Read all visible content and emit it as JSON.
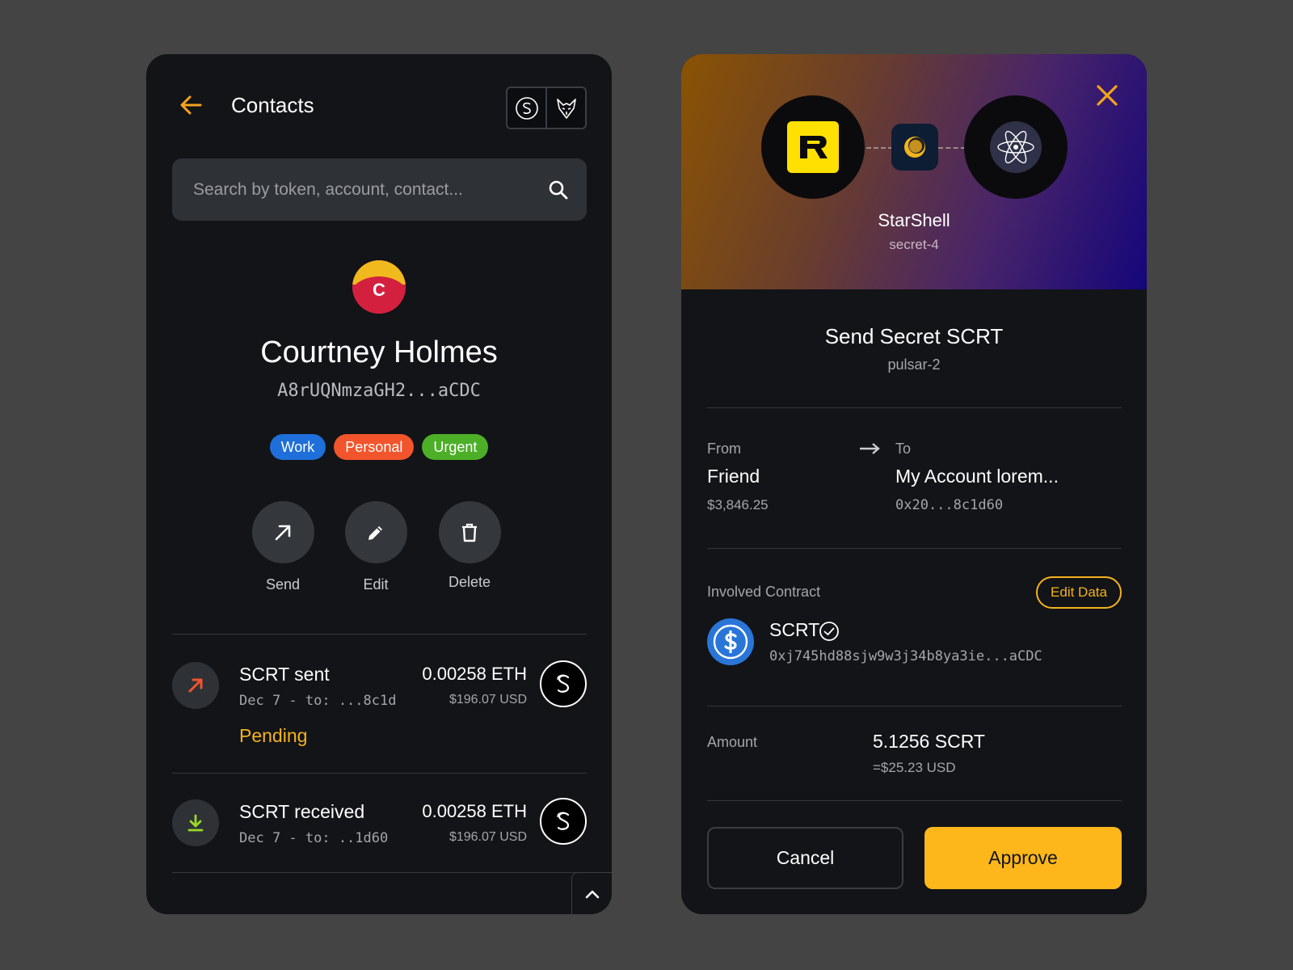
{
  "contacts": {
    "title": "Contacts",
    "search": {
      "placeholder": "Search by token, account, contact..."
    },
    "contact": {
      "initial": "C",
      "name": "Courtney Holmes",
      "address": "A8rUQNmzaGH2...aCDC",
      "tags": [
        {
          "label": "Work",
          "color": "#1e6fd9"
        },
        {
          "label": "Personal",
          "color": "#f2552c"
        },
        {
          "label": "Urgent",
          "color": "#4caf27"
        }
      ]
    },
    "actions": [
      {
        "label": "Send",
        "icon": "arrow-up-right-icon"
      },
      {
        "label": "Edit",
        "icon": "pencil-icon"
      },
      {
        "label": "Delete",
        "icon": "trash-icon"
      }
    ],
    "transactions": [
      {
        "title": "SCRT sent",
        "subtitle": "Dec 7 - to: ...8c1d",
        "status": "Pending",
        "amount": "0.00258 ETH",
        "usd": "$196.07 USD",
        "icon": "arrow-up-right-icon",
        "token_icon": "secret-network-icon"
      },
      {
        "title": "SCRT received",
        "subtitle": "Dec 7 - to: ..1d60",
        "status": "",
        "amount": "0.00258 ETH",
        "usd": "$196.07 USD",
        "icon": "download-icon",
        "token_icon": "secret-network-icon"
      }
    ]
  },
  "approval": {
    "app": {
      "name": "StarShell",
      "chain": "secret-4"
    },
    "request": {
      "title": "Send Secret SCRT",
      "chain": "pulsar-2"
    },
    "from": {
      "label": "From",
      "name": "Friend",
      "balance": "$3,846.25"
    },
    "to": {
      "label": "To",
      "name": "My Account lorem...",
      "address": "0x20...8c1d60"
    },
    "contract": {
      "label": "Involved Contract",
      "edit_label": "Edit Data",
      "token": "SCRT",
      "address": "0xj745hd88sjw9w3j34b8ya3ie...aCDC"
    },
    "amount": {
      "label": "Amount",
      "value": "5.1256 SCRT",
      "usd": "=$25.23 USD"
    },
    "buttons": {
      "cancel": "Cancel",
      "approve": "Approve"
    }
  },
  "colors": {
    "accent": "#f5b21e",
    "approve": "#fdb71b",
    "panel": "#121417",
    "background": "#444444"
  }
}
